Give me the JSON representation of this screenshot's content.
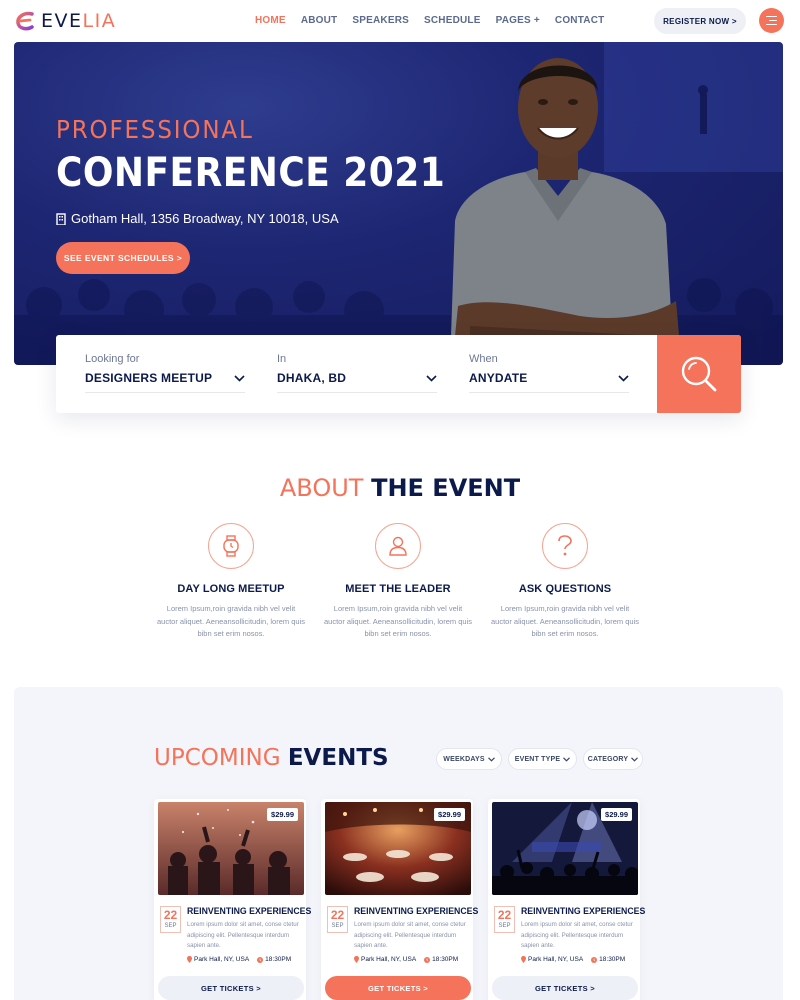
{
  "brand": {
    "name_part1": "EVE",
    "name_part2": "LIA"
  },
  "nav": [
    {
      "label": "HOME",
      "active": true
    },
    {
      "label": "ABOUT"
    },
    {
      "label": "SPEAKERS"
    },
    {
      "label": "SCHEDULE"
    },
    {
      "label": "PAGES +"
    },
    {
      "label": "CONTACT"
    }
  ],
  "header": {
    "register_label": "REGISTER NOW >"
  },
  "hero": {
    "subtitle": "PROFESSIONAL",
    "title": "CONFERENCE 2021",
    "location": "Gotham Hall, 1356 Broadway, NY 10018, USA",
    "cta_label": "SEE EVENT SCHEDULES >"
  },
  "search": {
    "fields": [
      {
        "label": "Looking for",
        "value": "DESIGNERS MEETUP"
      },
      {
        "label": "In",
        "value": "DHAKA, BD"
      },
      {
        "label": "When",
        "value": "ANYDATE"
      }
    ]
  },
  "about": {
    "title_part1": "ABOUT",
    "title_part2": "THE EVENT",
    "features": [
      {
        "icon": "watch-icon",
        "title": "DAY LONG MEETUP",
        "desc": "Lorem Ipsum,roin gravida nibh vel velit auctor aliquet. Aeneansollicitudin, lorem quis bibn set erim nosos."
      },
      {
        "icon": "user-icon",
        "title": "MEET THE LEADER",
        "desc": "Lorem Ipsum,roin gravida nibh vel velit auctor aliquet. Aeneansollicitudin, lorem quis bibn set erim nosos."
      },
      {
        "icon": "question-icon",
        "title": "ASK QUESTIONS",
        "desc": "Lorem Ipsum,roin gravida nibh vel velit auctor aliquet. Aeneansollicitudin, lorem quis bibn set erim nosos."
      }
    ]
  },
  "events": {
    "title_part1": "UPCOMING",
    "title_part2": "EVENTS",
    "filters": [
      "WEEKDAYS",
      "EVENT TYPE",
      "CATEGORY"
    ],
    "cards": [
      {
        "price": "$29.99",
        "day": "22",
        "month": "SEP",
        "title": "REINVENTING EXPERIENCES",
        "desc": "Lorem ipsum dolor sit amet, conse ctetur adipiscing elit. Pellentesque interdum sapien ante.",
        "location": "Park Hall, NY, USA",
        "time": "18:30PM",
        "ticket_label": "GET TICKETS >",
        "highlight": false
      },
      {
        "price": "$29.99",
        "day": "22",
        "month": "SEP",
        "title": "REINVENTING EXPERIENCES",
        "desc": "Lorem ipsum dolor sit amet, conse ctetur adipiscing elit. Pellentesque interdum sapien ante.",
        "location": "Park Hall, NY, USA",
        "time": "18:30PM",
        "ticket_label": "GET TICKETS >",
        "highlight": true
      },
      {
        "price": "$29.99",
        "day": "22",
        "month": "SEP",
        "title": "REINVENTING EXPERIENCES",
        "desc": "Lorem ipsum dolor sit amet, conse ctetur adipiscing elit. Pellentesque interdum sapien ante.",
        "location": "Park Hall, NY, USA",
        "time": "18:30PM",
        "ticket_label": "GET TICKETS >",
        "highlight": false
      }
    ]
  },
  "colors": {
    "accent": "#f4735a",
    "navy": "#0c1a4b",
    "hero_bg": "#1d2672"
  }
}
